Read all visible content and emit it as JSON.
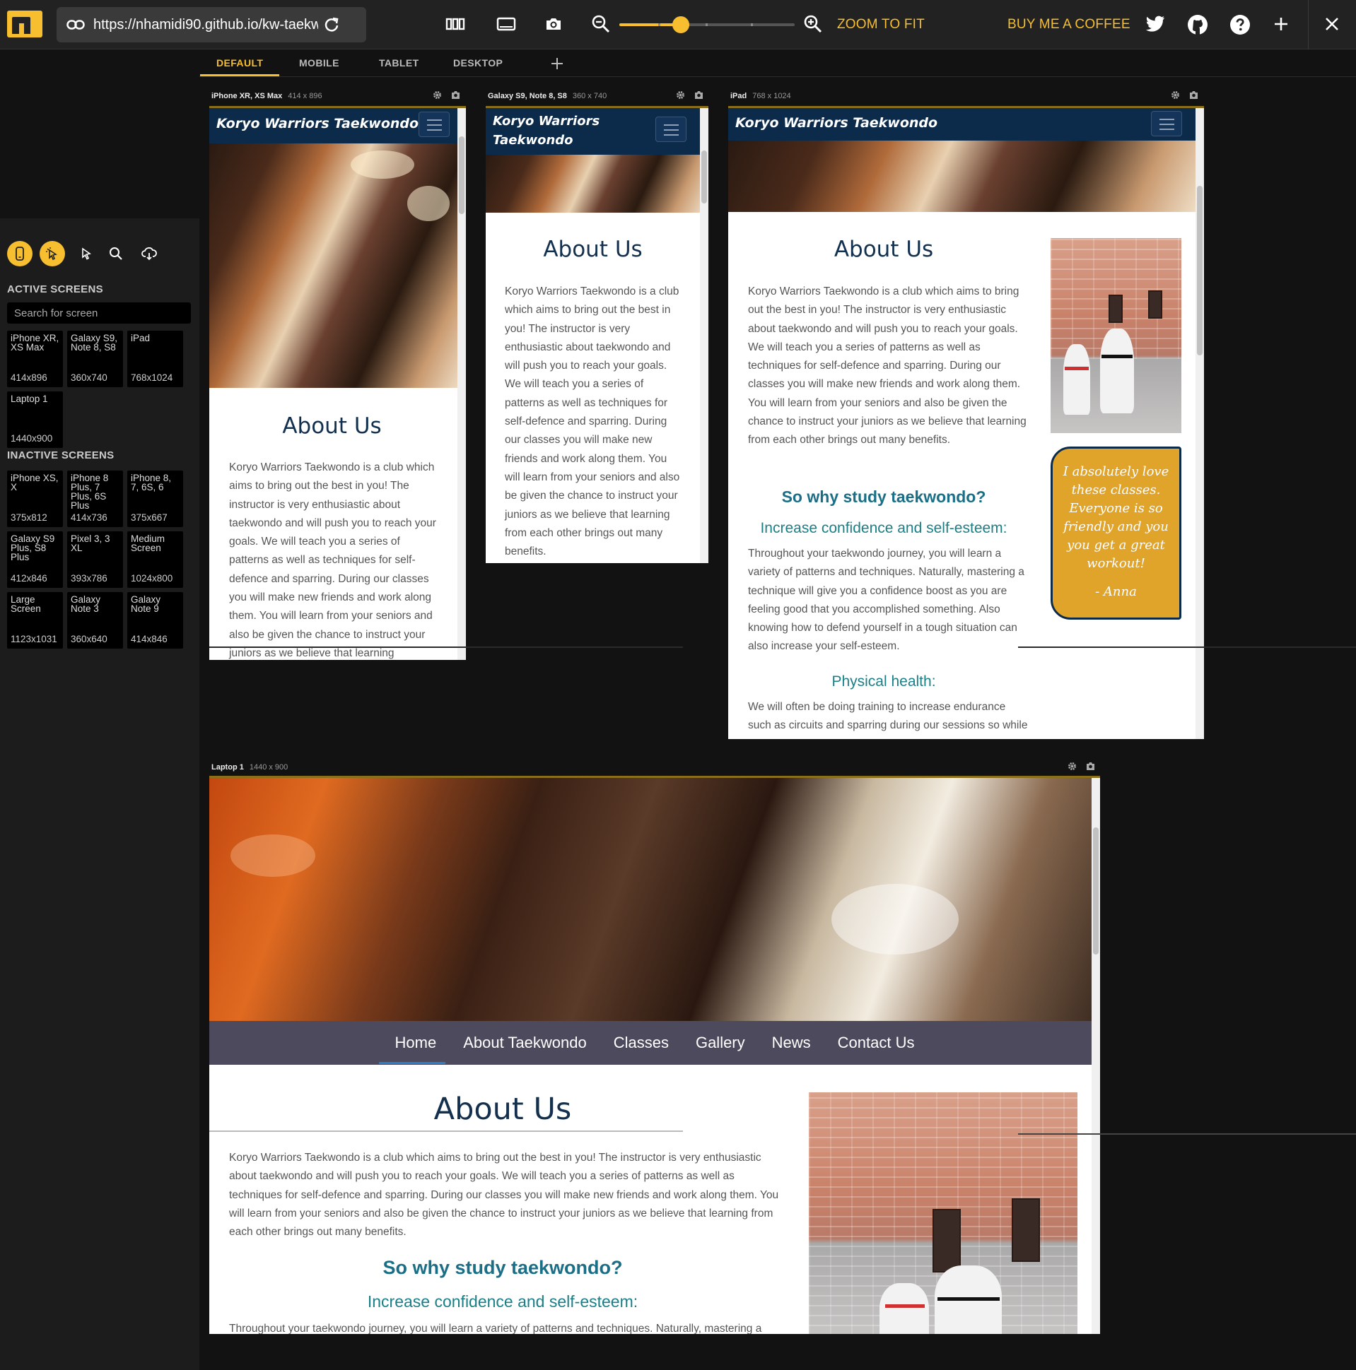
{
  "toolbar": {
    "url": "https://nhamidi90.github.io/kw-taekw",
    "zoom_to_fit": "ZOOM TO FIT",
    "buy_coffee": "BUY ME A COFFEE",
    "zoom_level": 0.35
  },
  "tabs": [
    "DEFAULT",
    "MOBILE",
    "TABLET",
    "DESKTOP"
  ],
  "sidebar": {
    "active_heading": "ACTIVE SCREENS",
    "search_placeholder": "Search for screen",
    "active": [
      {
        "name": "iPhone XR, XS Max",
        "res": "414x896"
      },
      {
        "name": "Galaxy S9, Note 8, S8",
        "res": "360x740"
      },
      {
        "name": "iPad",
        "res": "768x1024"
      },
      {
        "name": "Laptop 1",
        "res": "1440x900"
      }
    ],
    "inactive_heading": "INACTIVE SCREENS",
    "inactive": [
      {
        "name": "iPhone XS, X",
        "res": "375x812"
      },
      {
        "name": "iPhone 8 Plus, 7 Plus, 6S Plus",
        "res": "414x736"
      },
      {
        "name": "iPhone 8, 7, 6S, 6",
        "res": "375x667"
      },
      {
        "name": "Galaxy S9 Plus, S8 Plus",
        "res": "412x846"
      },
      {
        "name": "Pixel 3, 3 XL",
        "res": "393x786"
      },
      {
        "name": "Medium Screen",
        "res": "1024x800"
      },
      {
        "name": "Large Screen",
        "res": "1123x1031"
      },
      {
        "name": "Galaxy Note 3",
        "res": "360x640"
      },
      {
        "name": "Galaxy Note 9",
        "res": "414x846"
      }
    ]
  },
  "devices": {
    "iphone": {
      "name": "iPhone XR, XS Max",
      "res": "414 x 896"
    },
    "galaxy": {
      "name": "Galaxy S9, Note 8, S8",
      "res": "360 x 740"
    },
    "ipad": {
      "name": "iPad",
      "res": "768 x 1024"
    },
    "laptop": {
      "name": "Laptop 1",
      "res": "1440 x 900"
    }
  },
  "site": {
    "brand": "Koryo Warriors Taekwondo",
    "brand_line1": "Koryo Warriors",
    "brand_line2": "Taekwondo",
    "about_title": "About Us",
    "about_text": "Koryo Warriors Taekwondo is a club which aims to bring out the best in you! The instructor is very enthusiastic about taekwondo and will push you to reach your goals. We will teach you a series of patterns as well as techniques for self-defence and sparring. During our classes you will make new friends and work along them. You will learn from your seniors and also be given the chance to instruct your juniors as we believe that learning from each other brings out many benefits.",
    "why_title": "So why study taekwondo?",
    "confidence_title": "Increase confidence and self-esteem:",
    "confidence_text": "Throughout your taekwondo journey, you will learn a variety of patterns and techniques. Naturally, mastering a technique will give you a confidence boost as you are feeling good that you accomplished something. Also knowing how to defend yourself in a tough situation can also increase your self-esteem.",
    "physical_title": "Physical health:",
    "physical_text": "We will often be doing training to increase endurance such as circuits and sparring during our sessions so while it's not the same as other cardio centric sports it",
    "quote": "I absolutely love these classes. Everyone is so friendly and you you get a great workout!",
    "quote_author": "- Anna",
    "nav": [
      "Home",
      "About Taekwondo",
      "Classes",
      "Gallery",
      "News",
      "Contact Us"
    ],
    "iphone_about_visible": "Koryo Warriors Taekwondo is a club which aims to bring out the best in you! The instructor is very enthusiastic about taekwondo and will push you to reach your goals. We will teach you a series of patterns as well as techniques for self-defence and sparring. During our classes you will make new friends and work along them. You will learn from your seniors and also be given the chance to instruct your juniors as we believe that learning",
    "laptop_confidence_visible": "Throughout your taekwondo journey, you will learn a variety of patterns and techniques. Naturally, mastering a"
  }
}
